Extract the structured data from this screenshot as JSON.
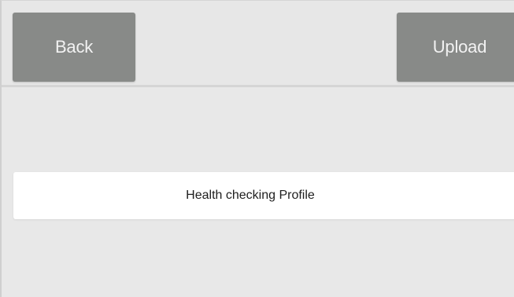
{
  "toolbar": {
    "back_label": "Back",
    "upload_label": "Upload"
  },
  "main": {
    "profile_item_label": "Health checking Profile"
  },
  "colors": {
    "button_bg": "#888a88",
    "button_text": "#f2f2f2",
    "background": "#e8e8e8",
    "row_bg": "#ffffff"
  }
}
